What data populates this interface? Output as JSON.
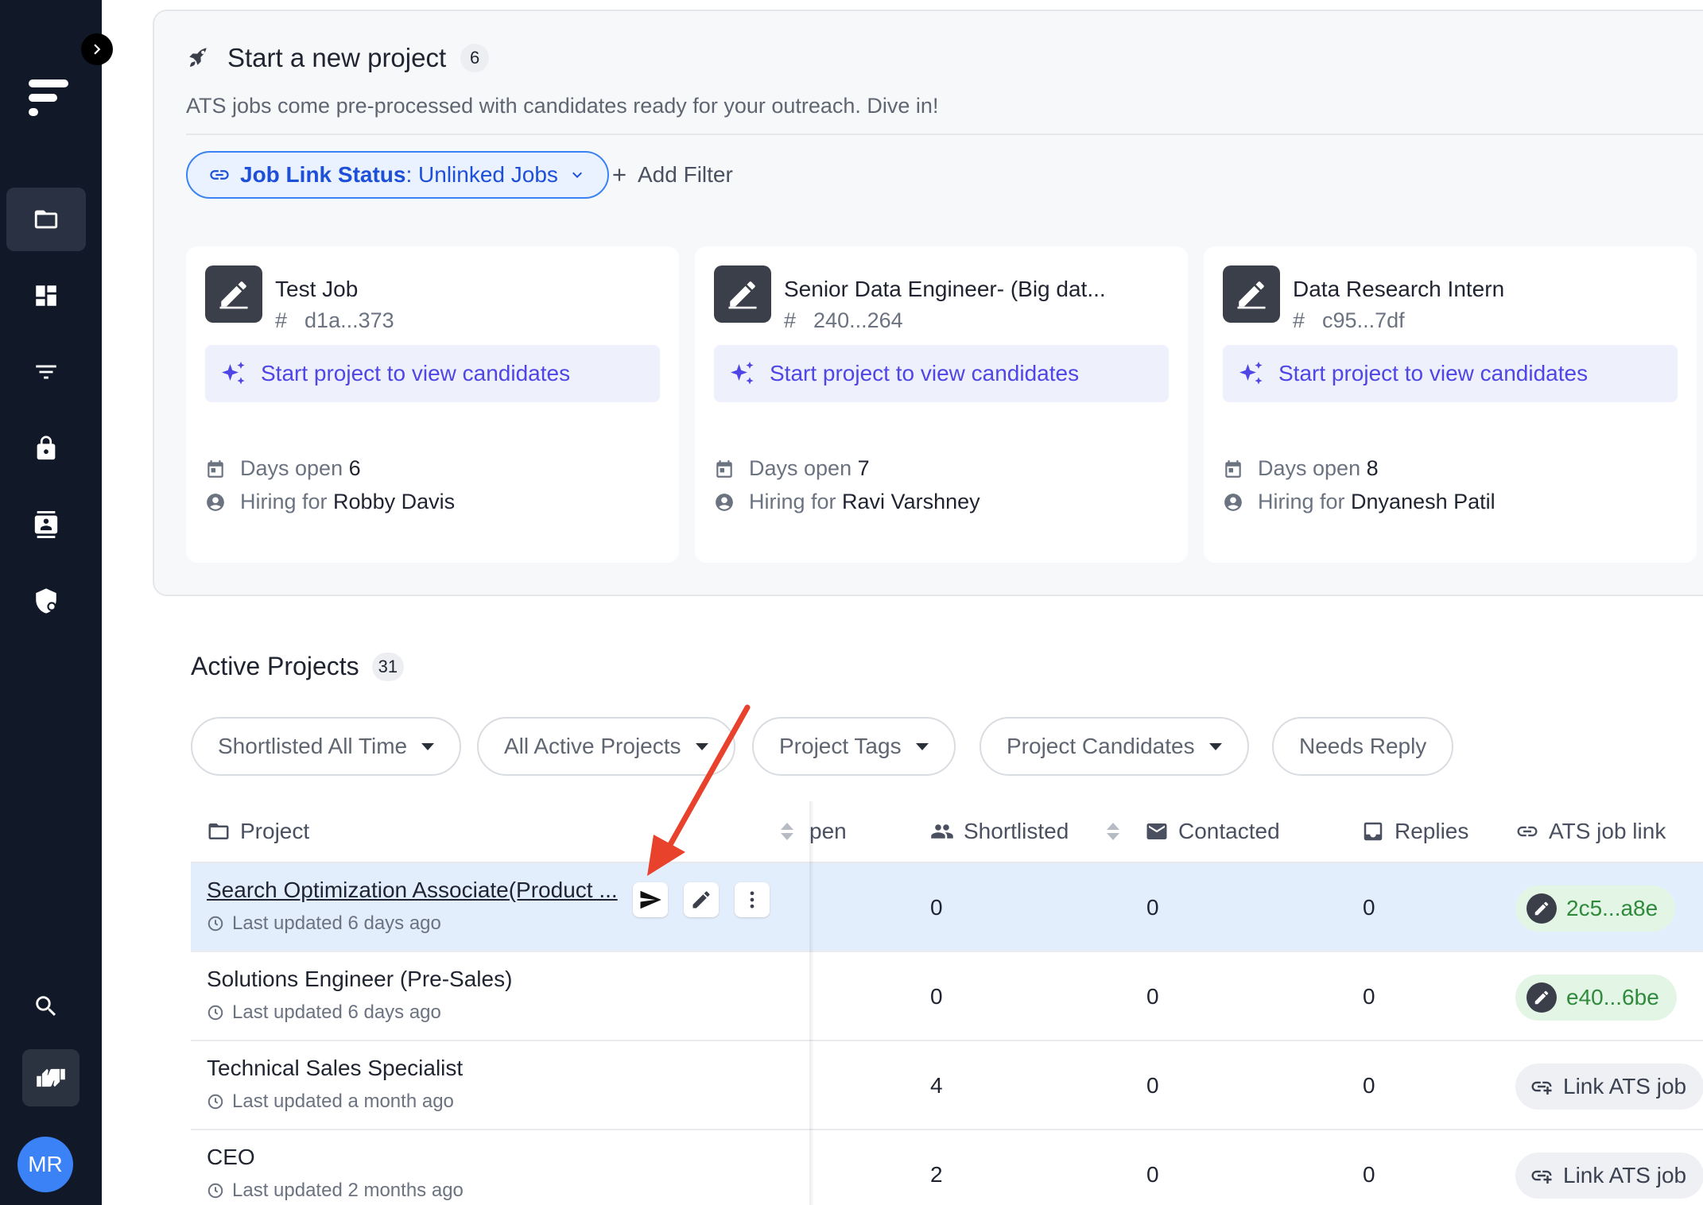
{
  "sidebar": {
    "avatar_initials": "MR",
    "nav": [
      "folder-icon",
      "dashboard-icon",
      "filter-icon",
      "lock-icon",
      "contacts-icon",
      "security-icon"
    ],
    "bottom": [
      "search-icon",
      "thumbs-up-down-icon"
    ]
  },
  "start_panel": {
    "title": "Start a new project",
    "count": "6",
    "subtitle": "ATS jobs come pre-processed with candidates ready for your outreach. Dive in!",
    "filter_key": "Job Link Status",
    "filter_sep": ":",
    "filter_value": "Unlinked Jobs",
    "add_filter": "Add Filter",
    "jobs": [
      {
        "title": "Test Job",
        "id": "d1a...373",
        "cta": "Start project to view candidates",
        "days_label": "Days open",
        "days": "6",
        "hiring_label": "Hiring for",
        "hiring": "Robby Davis"
      },
      {
        "title": "Senior Data Engineer- (Big dat...",
        "id": "240...264",
        "cta": "Start project to view candidates",
        "days_label": "Days open",
        "days": "7",
        "hiring_label": "Hiring for",
        "hiring": "Ravi Varshney"
      },
      {
        "title": "Data Research Intern",
        "id": "c95...7df",
        "cta": "Start project to view candidates",
        "days_label": "Days open",
        "days": "8",
        "hiring_label": "Hiring for",
        "hiring": "Dnyanesh Patil"
      }
    ]
  },
  "active_projects": {
    "title": "Active Projects",
    "count": "31",
    "filters": [
      "Shortlisted All Time",
      "All Active Projects",
      "Project Tags",
      "Project Candidates",
      "Needs Reply"
    ],
    "columns": {
      "project": "Project",
      "days_open": "pen",
      "shortlisted": "Shortlisted",
      "contacted": "Contacted",
      "replies": "Replies",
      "ats": "ATS job link"
    },
    "rows": [
      {
        "name": "Search Optimization Associate(Product ...",
        "updated": "Last updated 6 days ago",
        "shortlisted": "0",
        "contacted": "0",
        "replies": "0",
        "ats": "2c5...a8e",
        "ats_linked": true
      },
      {
        "name": "Solutions Engineer (Pre-Sales)",
        "updated": "Last updated 6 days ago",
        "shortlisted": "0",
        "contacted": "0",
        "replies": "0",
        "ats": "e40...6be",
        "ats_linked": true
      },
      {
        "name": "Technical Sales Specialist",
        "updated": "Last updated a month ago",
        "shortlisted": "4",
        "contacted": "0",
        "replies": "0",
        "ats": "Link ATS job",
        "ats_linked": false
      },
      {
        "name": "CEO",
        "updated": "Last updated 2 months ago",
        "shortlisted": "2",
        "contacted": "0",
        "replies": "0",
        "ats": "Link ATS job",
        "ats_linked": false
      }
    ]
  },
  "colors": {
    "sidebar": "#111827",
    "accent": "#3b82f6",
    "cta": "#4f46e5",
    "selected_row": "#e3eefc",
    "annotation_arrow": "#e8412c"
  }
}
